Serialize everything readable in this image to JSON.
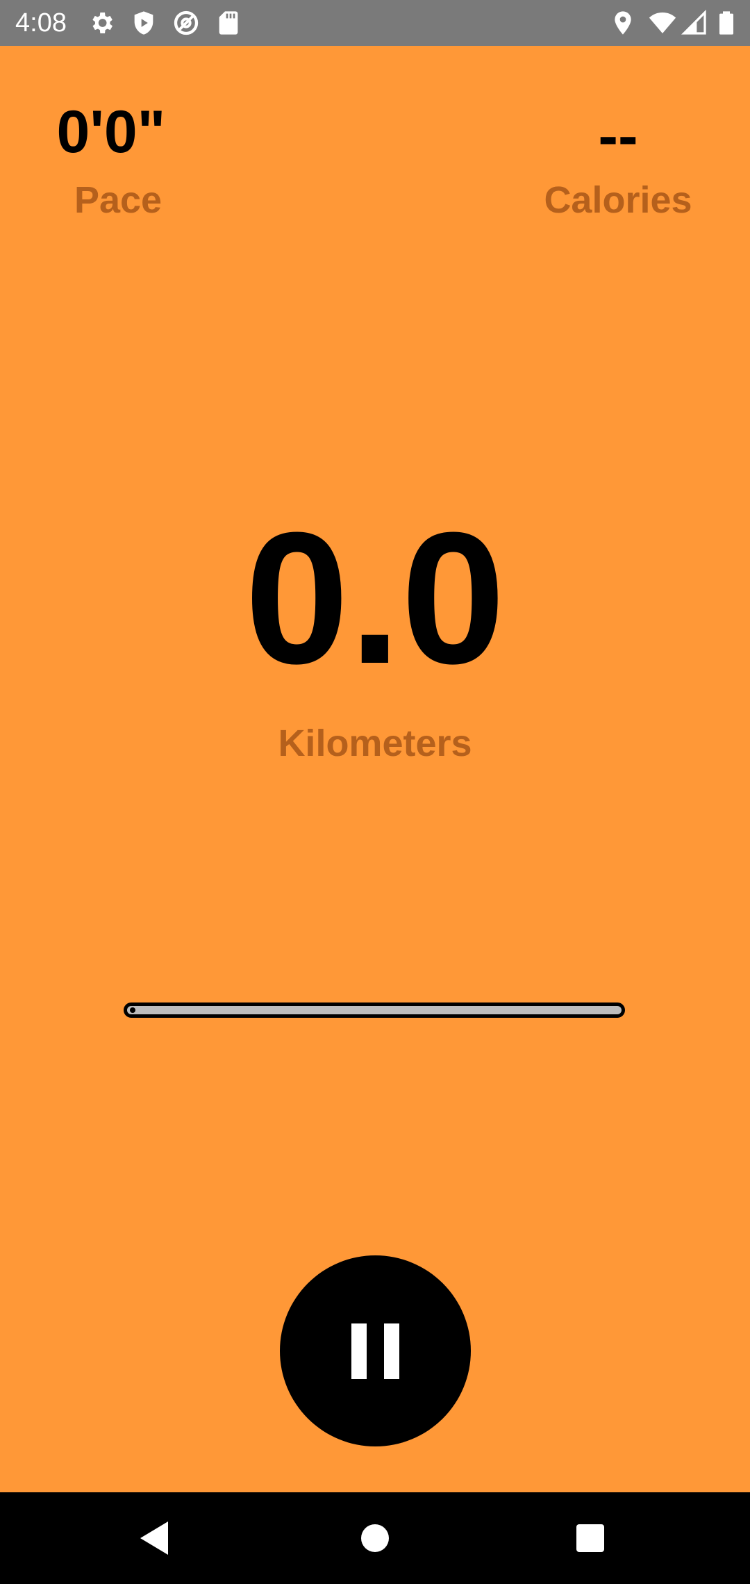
{
  "status_bar": {
    "time": "4:08",
    "left_icons": [
      "gear-icon",
      "shield-icon",
      "at-sign-icon",
      "sd-card-icon"
    ],
    "right_icons": [
      "location-icon",
      "wifi-icon",
      "signal-icon",
      "battery-icon"
    ]
  },
  "stats": {
    "pace": {
      "value": "0'0\"",
      "label": "Pace"
    },
    "calories": {
      "value": "--",
      "label": "Calories"
    },
    "distance": {
      "value": "0.0",
      "label": "Kilometers"
    }
  },
  "progress": {
    "fraction": 0.0
  },
  "controls": {
    "primary_action_icon": "pause-icon"
  },
  "nav_bar": {
    "buttons": [
      "back-icon",
      "home-icon",
      "recents-icon"
    ]
  },
  "colors": {
    "background": "#FF9837",
    "label": "#B5601C",
    "status_bar": "#7A7A7A",
    "nav_bar": "#000000"
  }
}
